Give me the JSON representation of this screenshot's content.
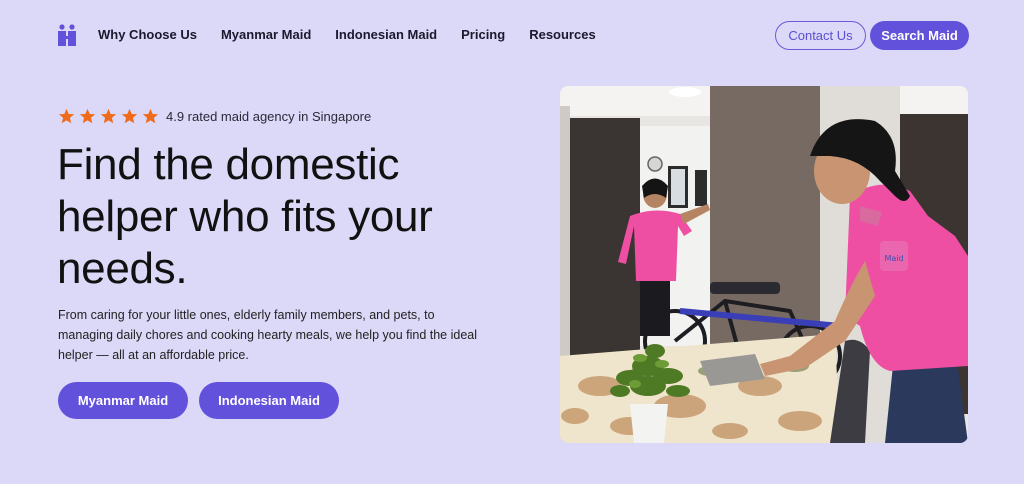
{
  "nav": {
    "logo_icon": "people-logo-icon",
    "links": [
      "Why Choose Us",
      "Myanmar Maid",
      "Indonesian Maid",
      "Pricing",
      "Resources"
    ],
    "contact_label": "Contact Us",
    "search_label": "Search Maid"
  },
  "hero": {
    "rating_text": "4.9 rated maid agency in Singapore",
    "stars": 5,
    "headline": "Find the domestic helper who fits your needs.",
    "description": "From caring for your little ones, elderly family members, and pets, to managing daily chores and cooking hearty meals, we help you find the ideal helper — all at an affordable price.",
    "cta_primary": "Myanmar Maid",
    "cta_secondary": "Indonesian Maid",
    "image_alt": "domestic helpers cleaning a home"
  },
  "colors": {
    "background": "#dcd8f7",
    "accent": "#6251db",
    "star": "#f06a1b",
    "uniform": "#ee4fa3"
  }
}
